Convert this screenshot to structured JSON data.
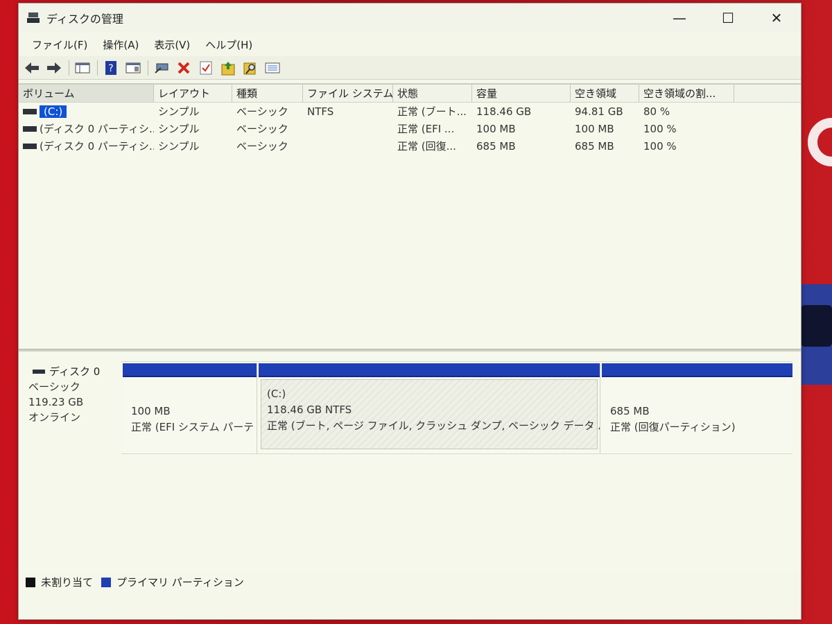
{
  "window": {
    "title": "ディスクの管理",
    "controls": {
      "minimize": "—",
      "maximize": "☐",
      "close": "✕"
    }
  },
  "menu": [
    "ファイル(F)",
    "操作(A)",
    "表示(V)",
    "ヘルプ(H)"
  ],
  "toolbar": {
    "icons": [
      "back-icon",
      "forward-icon",
      "console-tree-icon",
      "help-icon",
      "properties-icon",
      "connect-icon",
      "delete-icon",
      "check-icon",
      "folder-up-icon",
      "search-folder-icon",
      "list-view-icon"
    ]
  },
  "volume_list": {
    "columns": [
      "ボリューム",
      "レイアウト",
      "種類",
      "ファイル システム",
      "状態",
      "容量",
      "空き領域",
      "空き領域の割..."
    ],
    "rows": [
      {
        "volume": "(C:)",
        "layout": "シンプル",
        "type": "ベーシック",
        "fs": "NTFS",
        "status": "正常 (ブート...",
        "capacity": "118.46 GB",
        "free": "94.81 GB",
        "pct": "80 %"
      },
      {
        "volume": "(ディスク 0 パーティシ...",
        "layout": "シンプル",
        "type": "ベーシック",
        "fs": "",
        "status": "正常 (EFI ...",
        "capacity": "100 MB",
        "free": "100 MB",
        "pct": "100 %"
      },
      {
        "volume": "(ディスク 0 パーティシ...",
        "layout": "シンプル",
        "type": "ベーシック",
        "fs": "",
        "status": "正常 (回復...",
        "capacity": "685 MB",
        "free": "685 MB",
        "pct": "100 %"
      }
    ]
  },
  "disk": {
    "name": "ディスク 0",
    "type": "ベーシック",
    "size": "119.23 GB",
    "status": "オンライン",
    "partitions": [
      {
        "label": "",
        "size": "100 MB",
        "status": "正常 (EFI システム パーテ"
      },
      {
        "label": "(C:)",
        "size": "118.46 GB NTFS",
        "status": "正常 (ブート, ページ ファイル, クラッシュ ダンプ, ベーシック データ パーテ"
      },
      {
        "label": "",
        "size": "685 MB",
        "status": "正常 (回復パーティション)"
      }
    ]
  },
  "legend": [
    {
      "label": "未割り当て",
      "color": "#111111"
    },
    {
      "label": "プライマリ パーティション",
      "color": "#1f3fb5"
    }
  ]
}
